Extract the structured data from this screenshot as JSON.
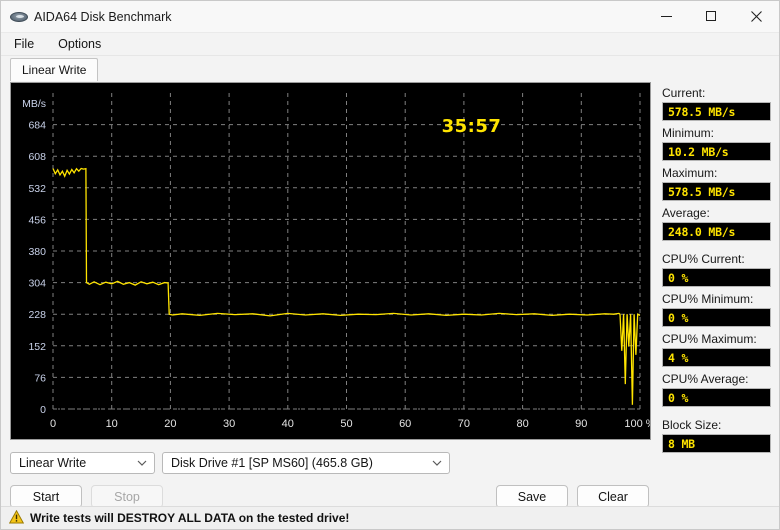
{
  "window": {
    "title": "AIDA64 Disk Benchmark",
    "icon": "disk-icon",
    "minimize_label": "Minimize",
    "maximize_label": "Maximize",
    "close_label": "Close"
  },
  "menubar": {
    "items": [
      {
        "label": "File"
      },
      {
        "label": "Options"
      }
    ]
  },
  "tabs": [
    {
      "label": "Linear Write",
      "active": true
    }
  ],
  "graph": {
    "timer": "35:57",
    "y_axis_title": "MB/s",
    "x_axis_unit": "%"
  },
  "controls": {
    "test_type": {
      "value": "Linear Write",
      "chevron": "chevron-down-icon"
    },
    "drive": {
      "value": "Disk Drive #1  [SP      MS60]  (465.8 GB)",
      "chevron": "chevron-down-icon"
    },
    "start_label": "Start",
    "stop_label": "Stop",
    "save_label": "Save",
    "clear_label": "Clear"
  },
  "stats": [
    {
      "label": "Current:",
      "value": "578.5 MB/s",
      "spaced": false
    },
    {
      "label": "Minimum:",
      "value": "10.2 MB/s",
      "spaced": false
    },
    {
      "label": "Maximum:",
      "value": "578.5 MB/s",
      "spaced": false
    },
    {
      "label": "Average:",
      "value": "248.0 MB/s",
      "spaced": false
    },
    {
      "label": "CPU% Current:",
      "value": "0 %",
      "spaced": true
    },
    {
      "label": "CPU% Minimum:",
      "value": "0 %",
      "spaced": false
    },
    {
      "label": "CPU% Maximum:",
      "value": "4 %",
      "spaced": false
    },
    {
      "label": "CPU% Average:",
      "value": "0 %",
      "spaced": false
    },
    {
      "label": "Block Size:",
      "value": "8 MB",
      "spaced": true
    }
  ],
  "warning": {
    "icon": "warning-triangle-icon",
    "text": "Write tests will DESTROY ALL DATA on the tested drive!"
  },
  "colors": {
    "plot_line": "#ffe400",
    "graph_bg": "#000000",
    "grid": "#808080",
    "y_label": "#c9d2ea",
    "x_label": "#e4e4e4",
    "value_text": "#ffe400",
    "warning_icon": "#f0c000"
  },
  "chart_data": {
    "type": "line",
    "title": "Linear Write",
    "xlabel": "%",
    "ylabel": "MB/s",
    "xlim": [
      0,
      100
    ],
    "ylim": [
      0,
      760
    ],
    "xticks": [
      0,
      10,
      20,
      30,
      40,
      50,
      60,
      70,
      80,
      90,
      100
    ],
    "xticklabels": [
      "0",
      "10",
      "20",
      "30",
      "40",
      "50",
      "60",
      "70",
      "80",
      "90",
      "100 %"
    ],
    "yticks": [
      0,
      76,
      152,
      228,
      304,
      380,
      456,
      532,
      608,
      684
    ],
    "yticklabels": [
      "0",
      "76",
      "152",
      "228",
      "304",
      "380",
      "456",
      "532",
      "608",
      "684"
    ],
    "grid": true,
    "legend": false,
    "series": [
      {
        "name": "Linear Write",
        "color": "#ffe400",
        "x": [
          0.0,
          0.4,
          0.8,
          1.2,
          1.6,
          2.0,
          2.4,
          2.8,
          3.2,
          3.6,
          4.0,
          4.4,
          4.8,
          5.2,
          5.6,
          5.7,
          6.2,
          7.0,
          8.0,
          9.0,
          10.0,
          11.0,
          12.0,
          13.0,
          14.0,
          15.0,
          16.0,
          17.0,
          18.0,
          19.0,
          19.6,
          19.8,
          20.4,
          22.0,
          25.0,
          28.0,
          31.0,
          34.0,
          37.0,
          40.0,
          43.0,
          46.0,
          49.0,
          52.0,
          55.0,
          58.0,
          61.0,
          64.0,
          67.0,
          70.0,
          73.0,
          76.0,
          79.0,
          82.0,
          85.0,
          88.0,
          91.0,
          94.0,
          95.5,
          96.4,
          96.6,
          96.9,
          97.2,
          97.5,
          97.8,
          98.1,
          98.4,
          98.7,
          99.0,
          99.3,
          99.6,
          100.0
        ],
        "y": [
          578.5,
          566.0,
          575.0,
          563.0,
          572.0,
          560.0,
          574.0,
          565.0,
          576.0,
          568.0,
          578.0,
          572.0,
          578.5,
          577.0,
          578.0,
          304.0,
          300.0,
          306.0,
          299.0,
          305.0,
          301.0,
          307.0,
          300.0,
          304.0,
          298.0,
          306.0,
          301.0,
          305.0,
          299.0,
          304.0,
          303.0,
          228.0,
          226.0,
          229.0,
          225.0,
          230.0,
          227.0,
          229.0,
          224.0,
          230.0,
          226.0,
          229.0,
          225.0,
          228.0,
          227.0,
          230.0,
          226.0,
          229.0,
          225.0,
          228.0,
          226.0,
          230.0,
          227.0,
          229.0,
          225.0,
          228.0,
          226.0,
          229.0,
          228.0,
          230.0,
          228.0,
          140.0,
          228.0,
          60.0,
          228.0,
          150.0,
          228.0,
          10.2,
          228.0,
          130.0,
          228.0,
          225.0
        ]
      }
    ],
    "annotations": [
      {
        "text": "35:57",
        "kind": "elapsed-timer",
        "color": "#ffe400"
      }
    ]
  }
}
